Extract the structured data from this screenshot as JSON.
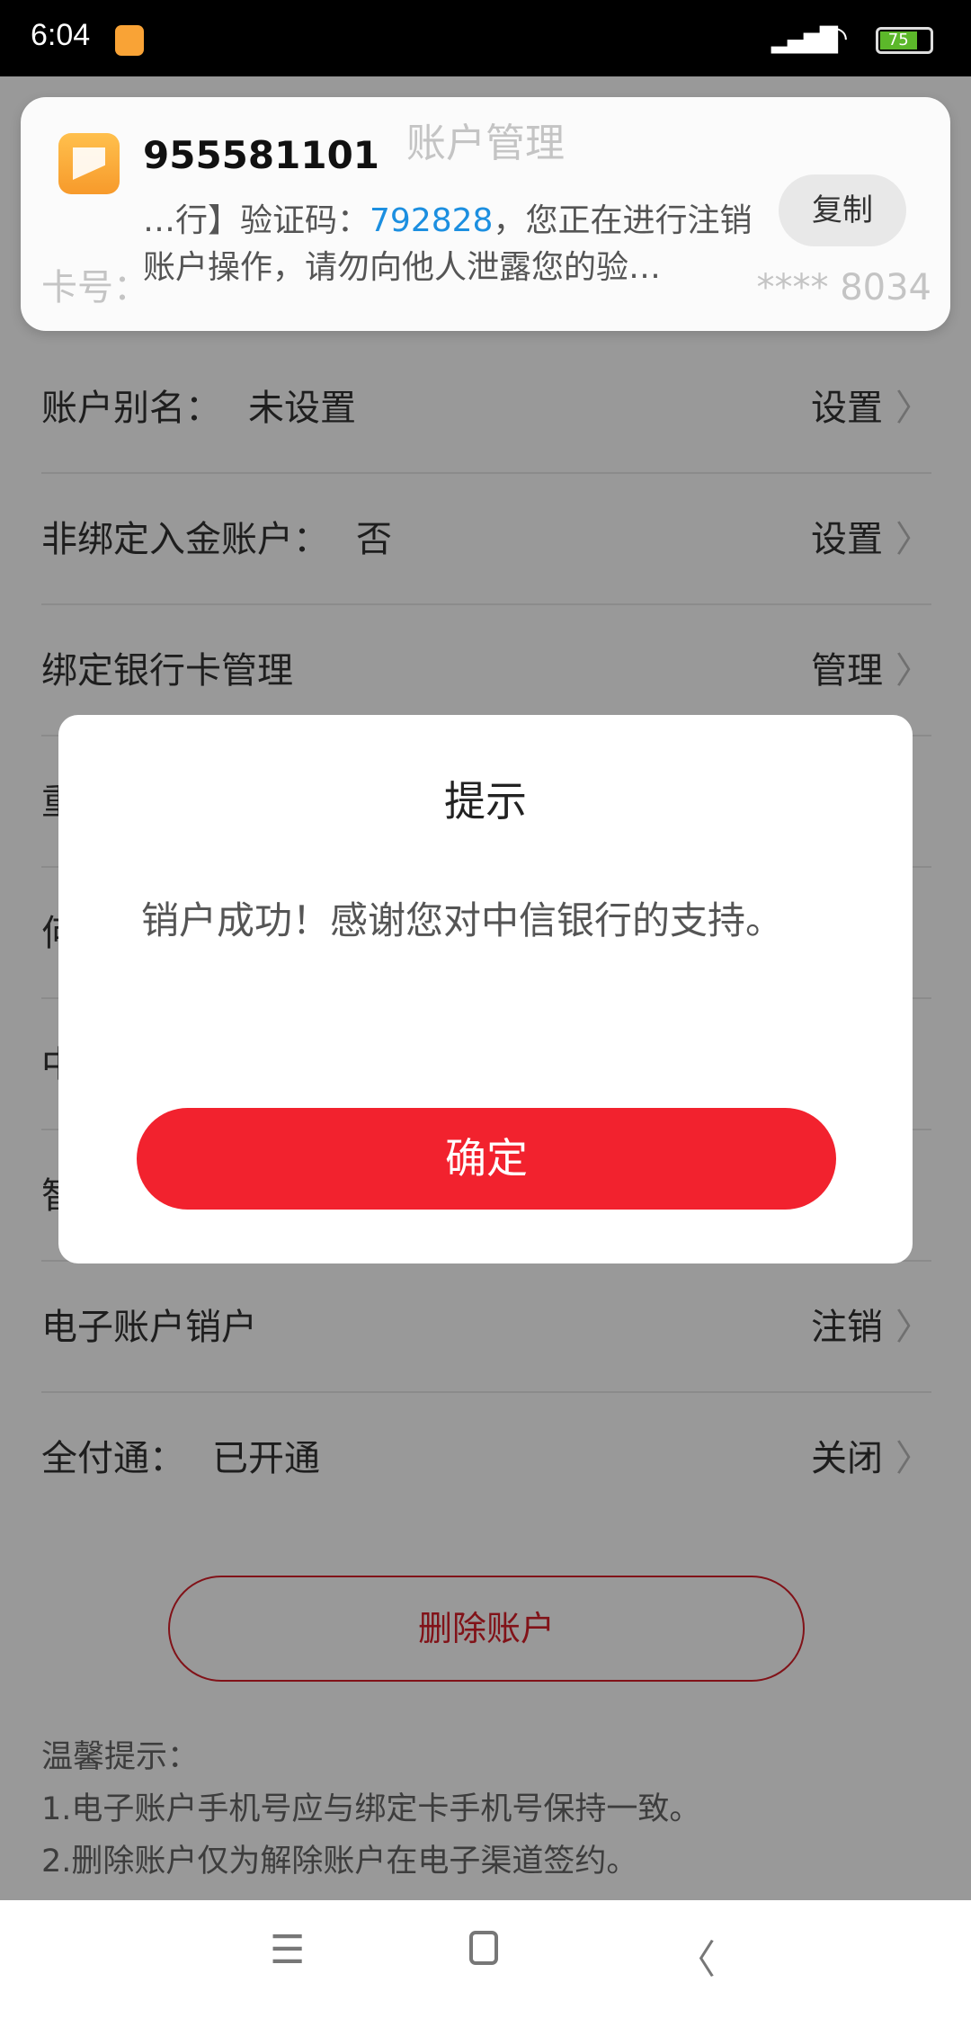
{
  "status_bar": {
    "time": "6:04",
    "battery": "75",
    "battery_level": 75
  },
  "header": {
    "title": "账户管理"
  },
  "card_row": {
    "label": "卡号：",
    "value": "**** 8034"
  },
  "rows": [
    {
      "label": "账户别名：",
      "value": "未设置",
      "action": "设置"
    },
    {
      "label": "非绑定入金账户：",
      "value": "否",
      "action": "设置"
    },
    {
      "label": "绑定银行卡管理",
      "value": "",
      "action": "管理"
    },
    {
      "label": "重",
      "value": "",
      "action": ""
    },
    {
      "label": "何",
      "value": "",
      "action": ""
    },
    {
      "label": "中",
      "value": "",
      "action": ""
    },
    {
      "label": "智",
      "value": "",
      "action": ""
    },
    {
      "label": "电子账户销户",
      "value": "",
      "action": "注销"
    },
    {
      "label": "全付通：",
      "value": "已开通",
      "action": "关闭"
    }
  ],
  "delete_button": "删除账户",
  "tips": {
    "title": "温馨提示：",
    "lines": [
      "1.电子账户手机号应与绑定卡手机号保持一致。",
      "2.删除账户仅为解除账户在电子渠道签约。"
    ]
  },
  "notification": {
    "sender": "955581101",
    "body_prefix": "…行】验证码：",
    "code": "792828",
    "body_suffix": "，您正在进行注销账户操作，请勿向他人泄露您的验…",
    "copy_label": "复制"
  },
  "dialog": {
    "title": "提示",
    "message": "销户成功！感谢您对中信银行的支持。",
    "confirm": "确定"
  },
  "colors": {
    "accent": "#f2222e",
    "code": "#1c8fe0"
  }
}
